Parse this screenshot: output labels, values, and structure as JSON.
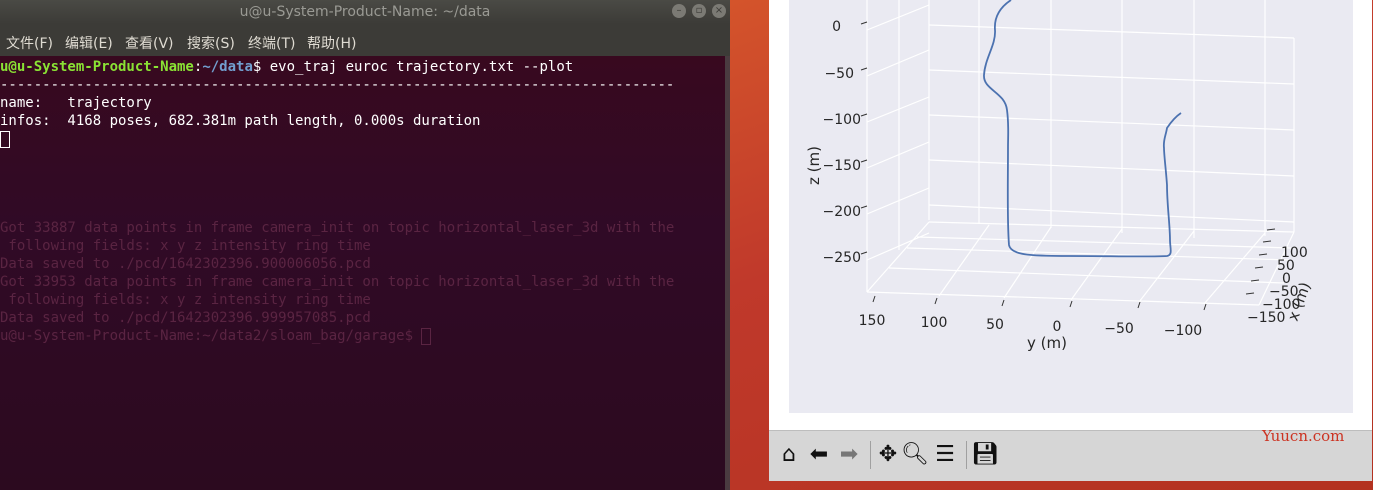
{
  "terminal": {
    "title": "u@u-System-Product-Name: ~/data",
    "menu": [
      "文件(F)",
      "编辑(E)",
      "查看(V)",
      "搜索(S)",
      "终端(T)",
      "帮助(H)"
    ],
    "prompt_user": "u@u-System-Product-Name",
    "prompt_path": "~/data",
    "command": "$ evo_traj euroc trajectory.txt --plot",
    "separator": "--------------------------------------------------------------------------------",
    "name_line": "name:   trajectory",
    "infos_line": "infos:  4168 poses, 682.381m path length, 0.000s duration",
    "ghost_lines": [
      "Got 33887 data points in frame camera_init on topic horizontal_laser_3d with the",
      " following fields: x y z intensity ring time",
      "Data saved to ./pcd/1642302396.900006056.pcd",
      "Got 33953 data points in frame camera_init on topic horizontal_laser_3d with the",
      " following fields: x y z intensity ring time",
      "Data saved to ./pcd/1642302396.999957085.pcd",
      "u@u-System-Product-Name:~/data2/sloam_bag/garage$ "
    ]
  },
  "plot": {
    "zlabel": "z (m)",
    "ylabel": "y (m)",
    "xlabel": "x (m)",
    "z_ticks": [
      "0",
      "−50",
      "−100",
      "−150",
      "−200",
      "−250"
    ],
    "y_ticks": [
      "150",
      "100",
      "50",
      "0",
      "−50",
      "−100"
    ],
    "x_ticks": [
      "100",
      "50",
      "0",
      "−50",
      "−100",
      "−150"
    ],
    "line_color": "#4c72b0"
  },
  "toolbar": {
    "home": "home-icon",
    "back": "back-arrow-icon",
    "forward": "forward-arrow-icon",
    "pan": "pan-icon",
    "zoom": "zoom-icon",
    "configure": "configure-subplots-icon",
    "save": "save-icon"
  },
  "watermark": "Yuucn.com"
}
